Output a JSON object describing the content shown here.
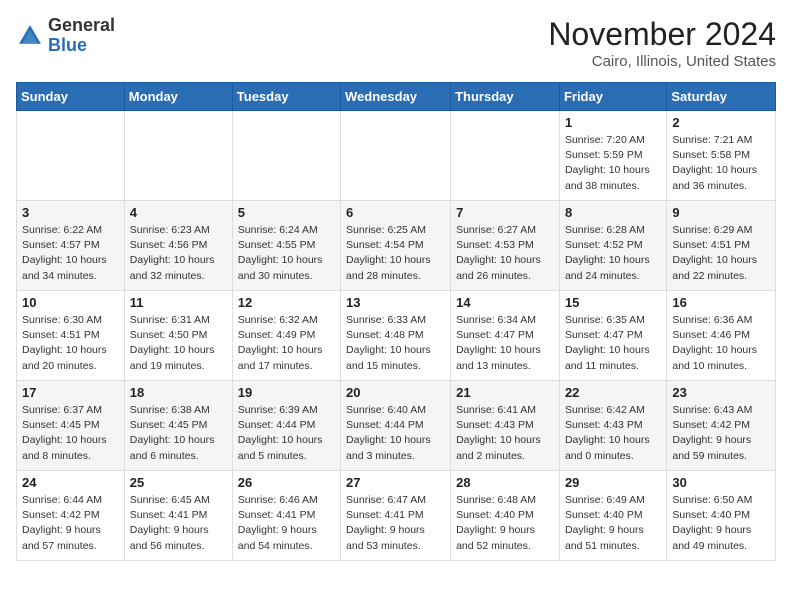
{
  "logo": {
    "general": "General",
    "blue": "Blue"
  },
  "header": {
    "month_year": "November 2024",
    "location": "Cairo, Illinois, United States"
  },
  "days_of_week": [
    "Sunday",
    "Monday",
    "Tuesday",
    "Wednesday",
    "Thursday",
    "Friday",
    "Saturday"
  ],
  "weeks": [
    [
      {
        "day": "",
        "info": ""
      },
      {
        "day": "",
        "info": ""
      },
      {
        "day": "",
        "info": ""
      },
      {
        "day": "",
        "info": ""
      },
      {
        "day": "",
        "info": ""
      },
      {
        "day": "1",
        "info": "Sunrise: 7:20 AM\nSunset: 5:59 PM\nDaylight: 10 hours\nand 38 minutes."
      },
      {
        "day": "2",
        "info": "Sunrise: 7:21 AM\nSunset: 5:58 PM\nDaylight: 10 hours\nand 36 minutes."
      }
    ],
    [
      {
        "day": "3",
        "info": "Sunrise: 6:22 AM\nSunset: 4:57 PM\nDaylight: 10 hours\nand 34 minutes."
      },
      {
        "day": "4",
        "info": "Sunrise: 6:23 AM\nSunset: 4:56 PM\nDaylight: 10 hours\nand 32 minutes."
      },
      {
        "day": "5",
        "info": "Sunrise: 6:24 AM\nSunset: 4:55 PM\nDaylight: 10 hours\nand 30 minutes."
      },
      {
        "day": "6",
        "info": "Sunrise: 6:25 AM\nSunset: 4:54 PM\nDaylight: 10 hours\nand 28 minutes."
      },
      {
        "day": "7",
        "info": "Sunrise: 6:27 AM\nSunset: 4:53 PM\nDaylight: 10 hours\nand 26 minutes."
      },
      {
        "day": "8",
        "info": "Sunrise: 6:28 AM\nSunset: 4:52 PM\nDaylight: 10 hours\nand 24 minutes."
      },
      {
        "day": "9",
        "info": "Sunrise: 6:29 AM\nSunset: 4:51 PM\nDaylight: 10 hours\nand 22 minutes."
      }
    ],
    [
      {
        "day": "10",
        "info": "Sunrise: 6:30 AM\nSunset: 4:51 PM\nDaylight: 10 hours\nand 20 minutes."
      },
      {
        "day": "11",
        "info": "Sunrise: 6:31 AM\nSunset: 4:50 PM\nDaylight: 10 hours\nand 19 minutes."
      },
      {
        "day": "12",
        "info": "Sunrise: 6:32 AM\nSunset: 4:49 PM\nDaylight: 10 hours\nand 17 minutes."
      },
      {
        "day": "13",
        "info": "Sunrise: 6:33 AM\nSunset: 4:48 PM\nDaylight: 10 hours\nand 15 minutes."
      },
      {
        "day": "14",
        "info": "Sunrise: 6:34 AM\nSunset: 4:47 PM\nDaylight: 10 hours\nand 13 minutes."
      },
      {
        "day": "15",
        "info": "Sunrise: 6:35 AM\nSunset: 4:47 PM\nDaylight: 10 hours\nand 11 minutes."
      },
      {
        "day": "16",
        "info": "Sunrise: 6:36 AM\nSunset: 4:46 PM\nDaylight: 10 hours\nand 10 minutes."
      }
    ],
    [
      {
        "day": "17",
        "info": "Sunrise: 6:37 AM\nSunset: 4:45 PM\nDaylight: 10 hours\nand 8 minutes."
      },
      {
        "day": "18",
        "info": "Sunrise: 6:38 AM\nSunset: 4:45 PM\nDaylight: 10 hours\nand 6 minutes."
      },
      {
        "day": "19",
        "info": "Sunrise: 6:39 AM\nSunset: 4:44 PM\nDaylight: 10 hours\nand 5 minutes."
      },
      {
        "day": "20",
        "info": "Sunrise: 6:40 AM\nSunset: 4:44 PM\nDaylight: 10 hours\nand 3 minutes."
      },
      {
        "day": "21",
        "info": "Sunrise: 6:41 AM\nSunset: 4:43 PM\nDaylight: 10 hours\nand 2 minutes."
      },
      {
        "day": "22",
        "info": "Sunrise: 6:42 AM\nSunset: 4:43 PM\nDaylight: 10 hours\nand 0 minutes."
      },
      {
        "day": "23",
        "info": "Sunrise: 6:43 AM\nSunset: 4:42 PM\nDaylight: 9 hours\nand 59 minutes."
      }
    ],
    [
      {
        "day": "24",
        "info": "Sunrise: 6:44 AM\nSunset: 4:42 PM\nDaylight: 9 hours\nand 57 minutes."
      },
      {
        "day": "25",
        "info": "Sunrise: 6:45 AM\nSunset: 4:41 PM\nDaylight: 9 hours\nand 56 minutes."
      },
      {
        "day": "26",
        "info": "Sunrise: 6:46 AM\nSunset: 4:41 PM\nDaylight: 9 hours\nand 54 minutes."
      },
      {
        "day": "27",
        "info": "Sunrise: 6:47 AM\nSunset: 4:41 PM\nDaylight: 9 hours\nand 53 minutes."
      },
      {
        "day": "28",
        "info": "Sunrise: 6:48 AM\nSunset: 4:40 PM\nDaylight: 9 hours\nand 52 minutes."
      },
      {
        "day": "29",
        "info": "Sunrise: 6:49 AM\nSunset: 4:40 PM\nDaylight: 9 hours\nand 51 minutes."
      },
      {
        "day": "30",
        "info": "Sunrise: 6:50 AM\nSunset: 4:40 PM\nDaylight: 9 hours\nand 49 minutes."
      }
    ]
  ]
}
